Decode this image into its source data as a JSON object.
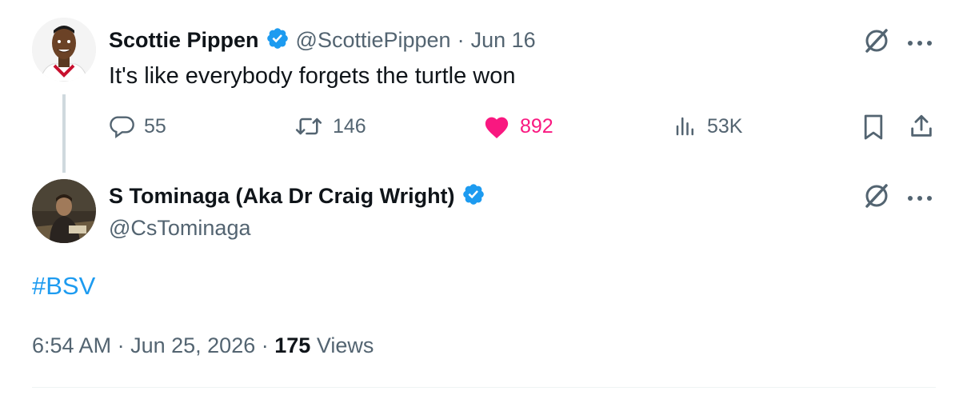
{
  "colors": {
    "accent": "#1d9bf0",
    "like": "#f91880",
    "muted": "#536471",
    "text": "#0f1419"
  },
  "quoted_tweet": {
    "author_name": "Scottie Pippen",
    "handle": "@ScottiePippen",
    "separator": "·",
    "date": "Jun 16",
    "text": "It's like everybody forgets the turtle won",
    "actions": {
      "replies": "55",
      "retweets": "146",
      "likes": "892",
      "views": "53K"
    },
    "icons": [
      "grok-icon",
      "more-icon",
      "reply-icon",
      "retweet-icon",
      "heart-icon",
      "views-icon",
      "bookmark-icon",
      "share-icon"
    ]
  },
  "main_tweet": {
    "author_name": "S Tominaga (Aka Dr Craig Wright)",
    "handle": "@CsTominaga",
    "text": "#BSV",
    "time": "6:54 AM",
    "separator": "·",
    "date": "Jun 25, 2026",
    "views_count": "175",
    "views_label": "Views"
  }
}
